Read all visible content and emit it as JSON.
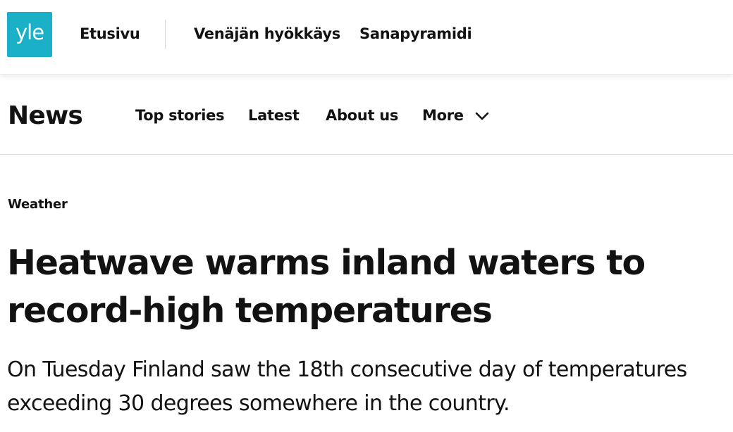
{
  "top_nav": {
    "logo_text": "yle",
    "links": [
      {
        "label": "Etusivu"
      },
      {
        "label": "Venäjän hyökkäys"
      },
      {
        "label": "Sanapyramidi"
      }
    ]
  },
  "sub_nav": {
    "title": "News",
    "links": [
      {
        "label": "Top stories"
      },
      {
        "label": "Latest"
      },
      {
        "label": "About us"
      }
    ],
    "more_label": "More",
    "more_icon": "chevron-down-icon"
  },
  "article": {
    "category": "Weather",
    "headline": "Heatwave warms inland waters to record-high temperatures",
    "lead": "On Tuesday Finland saw the 18th consecutive day of temperatures exceeding 30 degrees somewhere in the country."
  },
  "colors": {
    "brand": "#1ab0c8",
    "text": "#121212",
    "divider": "#dcdcdc"
  }
}
